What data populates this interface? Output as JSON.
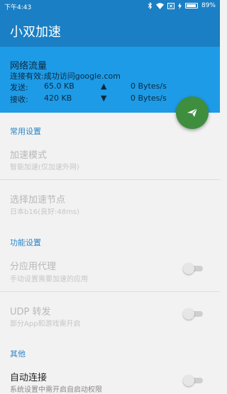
{
  "status_bar": {
    "time": "下午4:43",
    "battery_percent": "89%",
    "icons": [
      "bluetooth-icon",
      "wifi-icon",
      "sim-icon",
      "charging-icon",
      "battery-icon"
    ]
  },
  "app_bar": {
    "title": "小双加速"
  },
  "traffic": {
    "title": "网络流量",
    "connection": "连接有效:成功访问google.com",
    "send": {
      "label": "发送:",
      "value": "65.0 KB",
      "arrow": "▲",
      "rate": "0 Bytes/s"
    },
    "receive": {
      "label": "接收:",
      "value": "420 KB",
      "arrow": "▼",
      "rate": "0 Bytes/s"
    }
  },
  "fab": {
    "icon": "send-plane-icon"
  },
  "sections": {
    "common": "常用设置",
    "features": "功能设置",
    "other": "其他"
  },
  "items": {
    "mode": {
      "title": "加速模式",
      "subtitle": "智能加速(仅加速外网)"
    },
    "node": {
      "title": "选择加速节点",
      "subtitle": "日本b16(良好:48ms)"
    },
    "per_app": {
      "title": "分应用代理",
      "subtitle": "手动设置需要加速的应用",
      "on": false
    },
    "udp": {
      "title": "UDP 转发",
      "subtitle": "部分App和游戏需开启",
      "on": false
    },
    "auto_connect": {
      "title": "自动连接",
      "subtitle": "系统设置中需开启自启动权限",
      "on": false
    }
  },
  "colors": {
    "primary_dark": "#1a7fc4",
    "primary": "#1e9be6",
    "fab": "#3e8e3e",
    "section": "#2a86c8"
  }
}
